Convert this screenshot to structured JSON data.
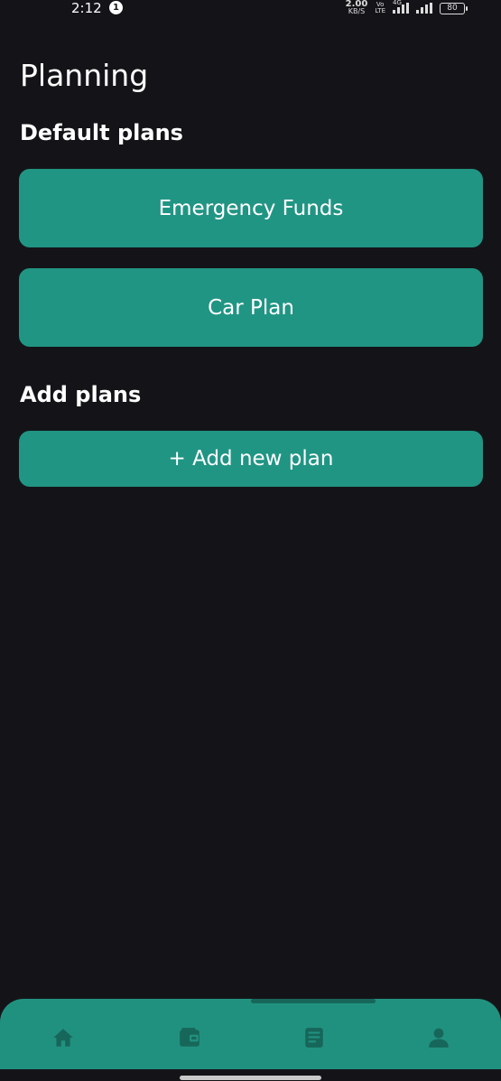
{
  "status_bar": {
    "time": "2:12",
    "notification_badge": "1",
    "net_speed_value": "2.00",
    "net_speed_unit": "KB/S",
    "volte_top": "Vo",
    "volte_bottom": "LTE",
    "network": "4G",
    "battery": "80"
  },
  "page": {
    "title": "Planning"
  },
  "default_plans": {
    "heading": "Default plans",
    "items": [
      {
        "label": "Emergency Funds"
      },
      {
        "label": "Car Plan"
      }
    ]
  },
  "add_plans": {
    "heading": "Add plans",
    "button_label": "+ Add new plan"
  },
  "bottom_nav": {
    "items": [
      {
        "icon": "home-icon"
      },
      {
        "icon": "wallet-icon"
      },
      {
        "icon": "document-icon"
      },
      {
        "icon": "profile-icon"
      }
    ]
  },
  "colors": {
    "background": "#141418",
    "accent": "#219584",
    "nav_background": "#21917f",
    "nav_icon": "#17665a"
  }
}
